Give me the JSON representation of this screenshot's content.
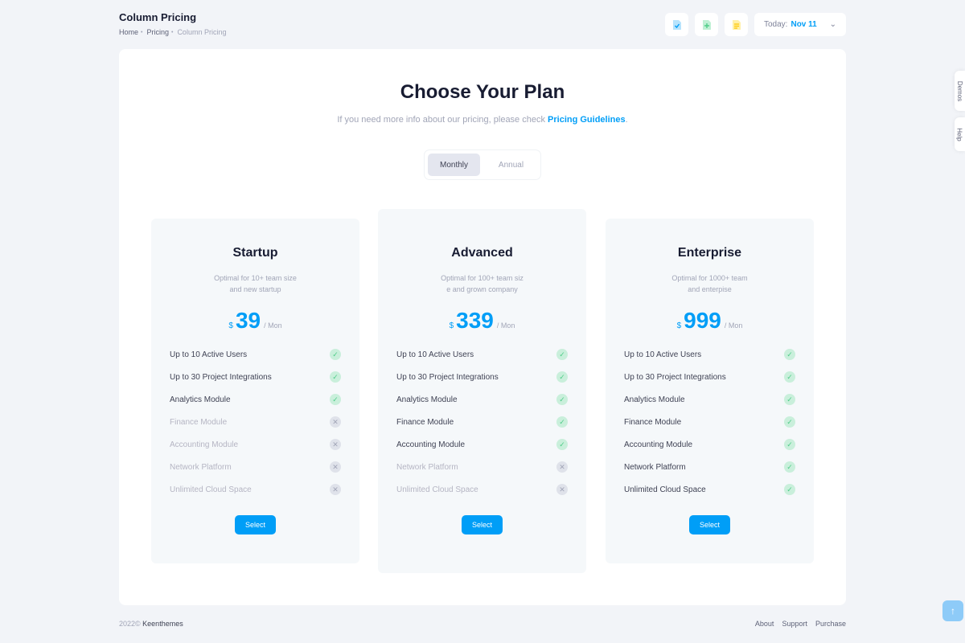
{
  "header": {
    "title": "Column Pricing",
    "breadcrumb": [
      "Home",
      "Pricing",
      "Column Pricing"
    ],
    "date_prefix": "Today:",
    "date_value": "Nov 11"
  },
  "toolbar": {
    "icons": [
      "file-check-icon",
      "file-plus-icon",
      "file-text-icon"
    ],
    "colors": {
      "check": "#009ef7",
      "plus": "#50cd89",
      "text": "#ffc700"
    }
  },
  "side_tabs": {
    "demos": "Demos",
    "help": "Help"
  },
  "main": {
    "title": "Choose Your Plan",
    "subtitle": "If you need more info about our pricing, please check ",
    "subtitle_link": "Pricing Guidelines",
    "subtitle_end": ".",
    "toggle": {
      "monthly": "Monthly",
      "annual": "Annual",
      "selected": "Monthly"
    }
  },
  "plans": [
    {
      "name": "Startup",
      "desc_1": "Optimal for 10+ team size",
      "desc_2": "and new startup",
      "currency": "$",
      "price": "39",
      "period": "/ Mon",
      "select": "Select",
      "features": [
        {
          "label": "Up to 10 Active Users",
          "included": true
        },
        {
          "label": "Up to 30 Project Integrations",
          "included": true
        },
        {
          "label": "Analytics Module",
          "included": true
        },
        {
          "label": "Finance Module",
          "included": false
        },
        {
          "label": "Accounting Module",
          "included": false
        },
        {
          "label": "Network Platform",
          "included": false
        },
        {
          "label": "Unlimited Cloud Space",
          "included": false
        }
      ]
    },
    {
      "name": "Advanced",
      "desc_1": "Optimal for 100+ team siz",
      "desc_2": "e and grown company",
      "currency": "$",
      "price": "339",
      "period": "/ Mon",
      "select": "Select",
      "features": [
        {
          "label": "Up to 10 Active Users",
          "included": true
        },
        {
          "label": "Up to 30 Project Integrations",
          "included": true
        },
        {
          "label": "Analytics Module",
          "included": true
        },
        {
          "label": "Finance Module",
          "included": true
        },
        {
          "label": "Accounting Module",
          "included": true
        },
        {
          "label": "Network Platform",
          "included": false
        },
        {
          "label": "Unlimited Cloud Space",
          "included": false
        }
      ]
    },
    {
      "name": "Enterprise",
      "desc_1": "Optimal for 1000+ team",
      "desc_2": "and enterpise",
      "currency": "$",
      "price": "999",
      "period": "/ Mon",
      "select": "Select",
      "features": [
        {
          "label": "Up to 10 Active Users",
          "included": true
        },
        {
          "label": "Up to 30 Project Integrations",
          "included": true
        },
        {
          "label": "Analytics Module",
          "included": true
        },
        {
          "label": "Finance Module",
          "included": true
        },
        {
          "label": "Accounting Module",
          "included": true
        },
        {
          "label": "Network Platform",
          "included": true
        },
        {
          "label": "Unlimited Cloud Space",
          "included": true
        }
      ]
    }
  ],
  "footer": {
    "year": "2022©",
    "brand": "Keenthemes",
    "links": [
      "About",
      "Support",
      "Purchase"
    ]
  },
  "colors": {
    "accent": "#009ef7",
    "success": "#50cd89",
    "muted": "#a1a5b7"
  }
}
